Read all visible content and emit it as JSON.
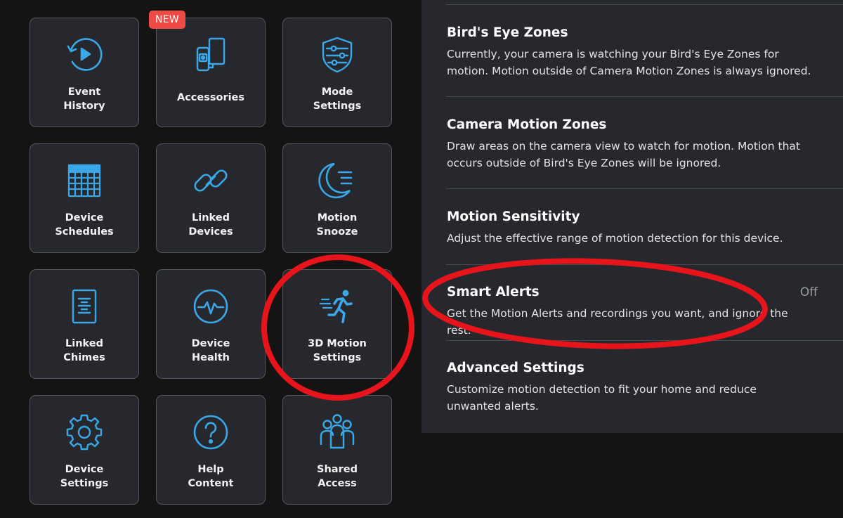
{
  "tiles": {
    "event_history": {
      "line1": "Event",
      "line2": "History",
      "icon": "play-history-icon"
    },
    "accessories": {
      "label": "Accessories",
      "badge": "NEW",
      "icon": "devices-icon"
    },
    "mode_settings": {
      "line1": "Mode",
      "line2": "Settings",
      "icon": "shield-sliders-icon"
    },
    "device_schedules": {
      "line1": "Device",
      "line2": "Schedules",
      "icon": "calendar-icon"
    },
    "linked_devices": {
      "line1": "Linked",
      "line2": "Devices",
      "icon": "link-icon"
    },
    "motion_snooze": {
      "line1": "Motion",
      "line2": "Snooze",
      "icon": "moon-lines-icon"
    },
    "linked_chimes": {
      "line1": "Linked",
      "line2": "Chimes",
      "icon": "chime-icon"
    },
    "device_health": {
      "line1": "Device",
      "line2": "Health",
      "icon": "pulse-icon"
    },
    "motion_3d_settings": {
      "line1": "3D Motion",
      "line2": "Settings",
      "icon": "running-person-icon"
    },
    "device_settings": {
      "line1": "Device",
      "line2": "Settings",
      "icon": "gear-icon"
    },
    "help_content": {
      "line1": "Help",
      "line2": "Content",
      "icon": "question-icon"
    },
    "shared_access": {
      "line1": "Shared",
      "line2": "Access",
      "icon": "people-icon"
    }
  },
  "settings": {
    "birds_eye_zones": {
      "title": "Bird's Eye Zones",
      "desc": "Currently, your camera is watching your Bird's Eye Zones for motion. Motion outside of Camera Motion Zones is always ignored."
    },
    "camera_motion_zones": {
      "title": "Camera Motion Zones",
      "desc": "Draw areas on the camera view to watch for motion. Motion that occurs outside of Bird's Eye Zones will be ignored."
    },
    "motion_sensitivity": {
      "title": "Motion Sensitivity",
      "desc": "Adjust the effective range of motion detection for this device."
    },
    "smart_alerts": {
      "title": "Smart Alerts",
      "value": "Off",
      "desc": "Get the Motion Alerts and recordings you want, and ignore the rest."
    },
    "advanced_settings": {
      "title": "Advanced Settings",
      "desc": "Customize motion detection to fit your home and reduce unwanted alerts."
    }
  },
  "colors": {
    "accent": "#3aa8e8",
    "tile_bg": "#26282d",
    "annotation": "#e8141b",
    "badge": "#ee4a46"
  }
}
